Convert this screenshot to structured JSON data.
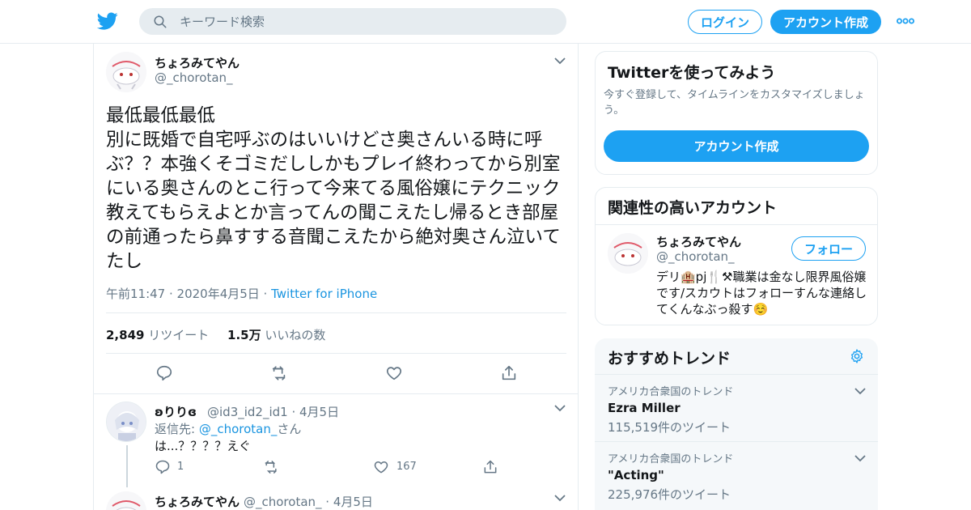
{
  "header": {
    "search_placeholder": "キーワード検索",
    "login_label": "ログイン",
    "signup_label": "アカウント作成"
  },
  "tweet": {
    "display_name": "ちょろみてやん",
    "handle": "@_chorotan_",
    "text": "最低最低最低\n別に既婚で自宅呼ぶのはいいけどさ奥さんいる時に呼ぶ？？本強くそゴミだししかもプレイ終わってから別室にいる奥さんのとこ行って今来てる風俗嬢にテクニック教えてもらえよとか言ってんの聞こえたし帰るとき部屋の前通ったら鼻すする音聞こえたから絶対奥さん泣いてたし",
    "time": "午前11:47 · 2020年4月5日 · ",
    "source": "Twitter for iPhone",
    "retweet_count": "2,849",
    "retweet_label": "リツイート",
    "like_count": "1.5万",
    "like_label": "いいねの数"
  },
  "reply": {
    "display_name": "ʚりりɞ",
    "handle": "@id3_id2_id1",
    "date": " · 4月5日",
    "reply_to_prefix": "返信先: ",
    "reply_to_handle": "@_chorotan_",
    "reply_to_suffix": "さん",
    "text": "は...？？？？えぐ",
    "reply_count": "1",
    "like_count": "167"
  },
  "next_reply": {
    "display_name": "ちょろみてやん",
    "handle": "@_chorotan_",
    "date": " · 4月5日"
  },
  "signup_card": {
    "title": "Twitterを使ってみよう",
    "description": "今すぐ登録して、タイムラインをカスタマイズしましょう。",
    "button_label": "アカウント作成"
  },
  "related_card": {
    "title": "関連性の高いアカウント",
    "display_name": "ちょろみてやん",
    "handle": "@_chorotan_",
    "follow_label": "フォロー",
    "bio": "デリ🏨pj🍴⚒職業は金なし限界風俗嬢です/スカウトはフォローすんな連絡してくんなぶっ殺す☺️"
  },
  "trends": {
    "title": "おすすめトレンド",
    "items": [
      {
        "context": "アメリカ合衆国のトレンド",
        "name": "Ezra Miller",
        "count": "115,519件のツイート"
      },
      {
        "context": "アメリカ合衆国のトレンド",
        "name": "\"Acting\"",
        "count": "225,976件のツイート"
      }
    ]
  },
  "colors": {
    "accent": "#1da1f2",
    "link": "#1b95e0",
    "secondary_text": "#657786"
  }
}
